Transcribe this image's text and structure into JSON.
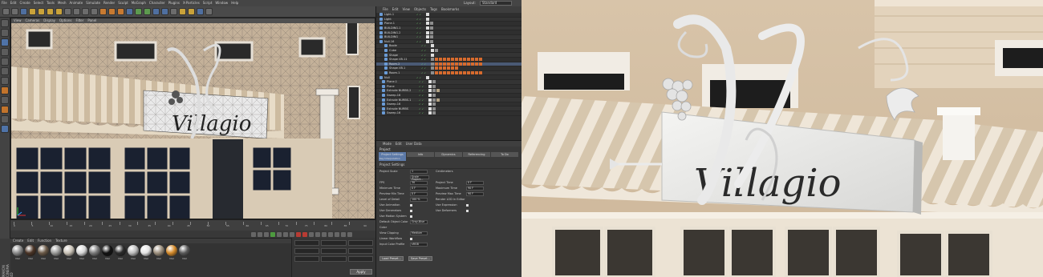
{
  "app": {
    "menu": [
      "File",
      "Edit",
      "Create",
      "Select",
      "Tools",
      "Mesh",
      "Animate",
      "Simulate",
      "Render",
      "Sculpt",
      "MoGraph",
      "Character",
      "Plugins",
      "X-Particles",
      "Script",
      "Window",
      "Help"
    ],
    "layout_label": "Layout:",
    "layout_value": "Standard",
    "logo": "MAXON CINEMA 4D"
  },
  "viewport": {
    "menu": [
      "View",
      "Cameras",
      "Display",
      "Options",
      "Filter",
      "Panel"
    ],
    "sign_text": "Villagio"
  },
  "timeline": {
    "ticks": [
      "0",
      "5",
      "10",
      "15",
      "20",
      "25",
      "30",
      "35",
      "40",
      "45",
      "50",
      "55",
      "60",
      "65",
      "70",
      "75",
      "80",
      "85",
      "90"
    ],
    "frame_start": "0 F",
    "frame_end": "90 F"
  },
  "materials": {
    "menu": [
      "Create",
      "Edit",
      "Function",
      "Texture"
    ],
    "items": [
      {
        "name": "Mat",
        "color": "#8a8a8a"
      },
      {
        "name": "Mat",
        "color": "#4a3426"
      },
      {
        "name": "Mat",
        "color": "#6b5a48"
      },
      {
        "name": "Mat",
        "color": "#9a9a98"
      },
      {
        "name": "Mat",
        "color": "#c9c2b6"
      },
      {
        "name": "Mat",
        "color": "#d8d8d8"
      },
      {
        "name": "Mat",
        "color": "#7a7a7a"
      },
      {
        "name": "Mat",
        "color": "#111111"
      },
      {
        "name": "Mat",
        "color": "#2c2c2c"
      },
      {
        "name": "Mat",
        "color": "#bdbdbd"
      },
      {
        "name": "Mat",
        "color": "#e4e4e4"
      },
      {
        "name": "Mat",
        "color": "#9c8f7d"
      },
      {
        "name": "Mat",
        "color": "#d48a2a"
      },
      {
        "name": "Mat",
        "color": "#5a5a5a"
      }
    ]
  },
  "coords": {
    "apply": "Apply"
  },
  "object_manager": {
    "menu": [
      "File",
      "Edit",
      "View",
      "Objects",
      "Tags",
      "Bookmarks"
    ],
    "rows": [
      {
        "name": "Light.1",
        "sel": false
      },
      {
        "name": "Light",
        "sel": false
      },
      {
        "name": "Plane.1",
        "sel": false
      },
      {
        "name": "BUILDING.1",
        "sel": false
      },
      {
        "name": "BUILDING.2",
        "sel": false
      },
      {
        "name": "BUILDING",
        "sel": false
      },
      {
        "name": "Null.16",
        "sel": false
      },
      {
        "name": "Boole",
        "sel": false
      },
      {
        "name": "Cube",
        "sel": false
      },
      {
        "name": "Shape",
        "sel": false
      },
      {
        "name": "Shape.VB.11",
        "sel": false
      },
      {
        "name": "Room.2",
        "sel": true
      },
      {
        "name": "Shape.VB.1",
        "sel": false
      },
      {
        "name": "Room.1",
        "sel": false
      },
      {
        "name": "Null",
        "sel": false
      },
      {
        "name": "Plane.1",
        "sel": false
      },
      {
        "name": "Plane",
        "sel": false
      },
      {
        "name": "Extrude NURBS.2",
        "sel": false
      },
      {
        "name": "Sweep.16",
        "sel": false
      },
      {
        "name": "Extrude NURBS.1",
        "sel": false
      },
      {
        "name": "Sweep.16",
        "sel": false
      },
      {
        "name": "Extrude NURBS",
        "sel": false
      },
      {
        "name": "Sweep.16",
        "sel": false
      }
    ]
  },
  "attributes": {
    "menu": [
      "Mode",
      "Edit",
      "User Data"
    ],
    "header": "Project",
    "tabs": [
      "Project Settings",
      "Info",
      "Dynamics",
      "Referencing",
      "To Do"
    ],
    "subtab": "Key Interpolation",
    "section": "Project Settings",
    "rows": [
      {
        "l": "Project Scale",
        "v": "1",
        "l2": "Centimeters",
        "v2": ""
      },
      {
        "l": "",
        "v": "Scale Project...",
        "l2": "",
        "v2": ""
      },
      {
        "l": "FPS",
        "v": "30",
        "l2": "Project Time",
        "v2": "0 F"
      },
      {
        "l": "Minimum Time",
        "v": "0 F",
        "l2": "Maximum Time",
        "v2": "90 F"
      },
      {
        "l": "Preview Min Time",
        "v": "0 F",
        "l2": "Preview Max Time",
        "v2": "90 F"
      },
      {
        "l": "Level of Detail",
        "v": "100 %",
        "l2": "Render LOD in Editor",
        "v2": ""
      },
      {
        "l": "Use Animation",
        "v": "",
        "l2": "Use Expression",
        "v2": ""
      },
      {
        "l": "Use Generators",
        "v": "",
        "l2": "Use Deformers",
        "v2": ""
      },
      {
        "l": "Use Motion System",
        "v": "",
        "l2": "",
        "v2": ""
      },
      {
        "l": "Default Object Color",
        "v": "Gray-Blue",
        "l2": "",
        "v2": ""
      },
      {
        "l": "Color",
        "v": "",
        "l2": "",
        "v2": ""
      },
      {
        "l": "View Clipping",
        "v": "Medium",
        "l2": "",
        "v2": ""
      },
      {
        "l": "Linear Workflow",
        "v": "",
        "l2": "",
        "v2": ""
      },
      {
        "l": "Input Color Profile",
        "v": "sRGB",
        "l2": "",
        "v2": ""
      }
    ],
    "buttons": [
      "Load Preset...",
      "Save Preset..."
    ]
  },
  "render": {
    "sign_text": "Villagio"
  }
}
